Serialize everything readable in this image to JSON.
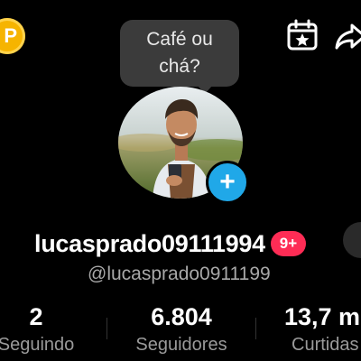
{
  "header": {
    "coin_badge_letter": "P",
    "calendar_icon": "calendar-star-icon",
    "share_icon": "share-arrow-icon"
  },
  "tooltip": {
    "line1": "Café ou",
    "line2": "chá?"
  },
  "profile": {
    "username": "lucasprado09111994",
    "notification_badge": "9+",
    "handle": "@lucasprado0911199",
    "add_icon": "+"
  },
  "stats": [
    {
      "value": "2",
      "label": "Seguindo"
    },
    {
      "value": "6.804",
      "label": "Seguidores"
    },
    {
      "value": "13,7 m",
      "label": "Curtidas"
    }
  ],
  "colors": {
    "background": "#000000",
    "badge_red": "#fe2c55",
    "add_blue": "#20a8e8",
    "coin_gold": "#f6b400"
  }
}
